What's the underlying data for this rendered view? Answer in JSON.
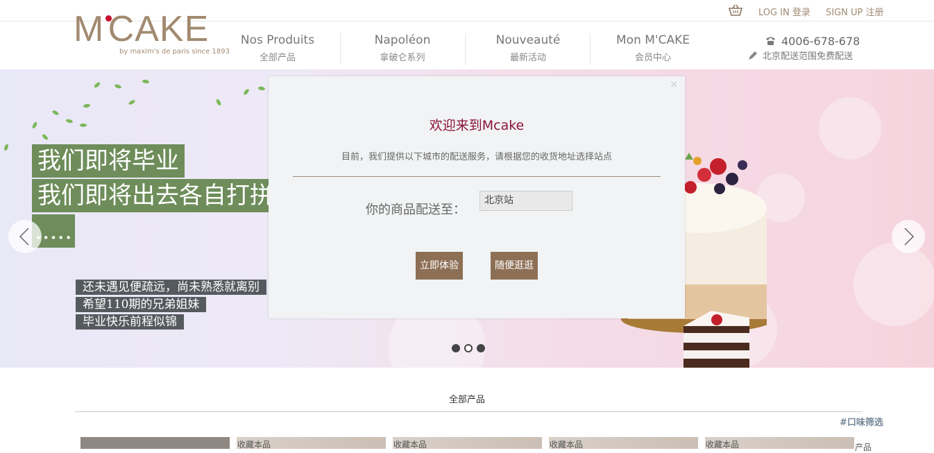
{
  "topbar": {
    "login": "LOG IN 登录",
    "signup": "SIGN UP 注册"
  },
  "logo": {
    "mark": "MCAKE",
    "tagline": "by maxim's de paris since 1893"
  },
  "nav": [
    {
      "en": "Nos Produits",
      "cn": "全部产品"
    },
    {
      "en": "Napoléon",
      "cn": "拿破仑系列"
    },
    {
      "en": "Nouveauté",
      "cn": "最新活动"
    },
    {
      "en": "Mon M'CAKE",
      "cn": "会员中心"
    }
  ],
  "contact": {
    "phone": "4006-678-678",
    "delivery": "北京配送范围免费配送"
  },
  "hero": {
    "headline_lines": [
      "我们即将毕业",
      "我们即将出去各自打拼",
      "....."
    ],
    "sub_lines": [
      "还未遇见便疏远，尚未熟悉就离别",
      "希望110期的兄弟姐妹",
      "毕业快乐前程似锦"
    ],
    "slide_count": 3,
    "active_slide": 2
  },
  "modal": {
    "close": "×",
    "title": "欢迎来到Mcake",
    "desc": "目前，我们提供以下城市的配送服务，请根据您的收货地址选择站点",
    "label": "你的商品配送至：",
    "select_value": "北京站",
    "btn_experience": "立即体验",
    "btn_browse": "随便逛逛"
  },
  "products": {
    "section_title": "全部产品",
    "filter_link": "#口味筛选",
    "favorite_label": "收藏本品",
    "edge_text": "产品"
  },
  "colors": {
    "brand": "#a28a70",
    "modal_title": "#8a1538",
    "button": "#8d6f55",
    "headline_bg": "#6e8d5a"
  }
}
